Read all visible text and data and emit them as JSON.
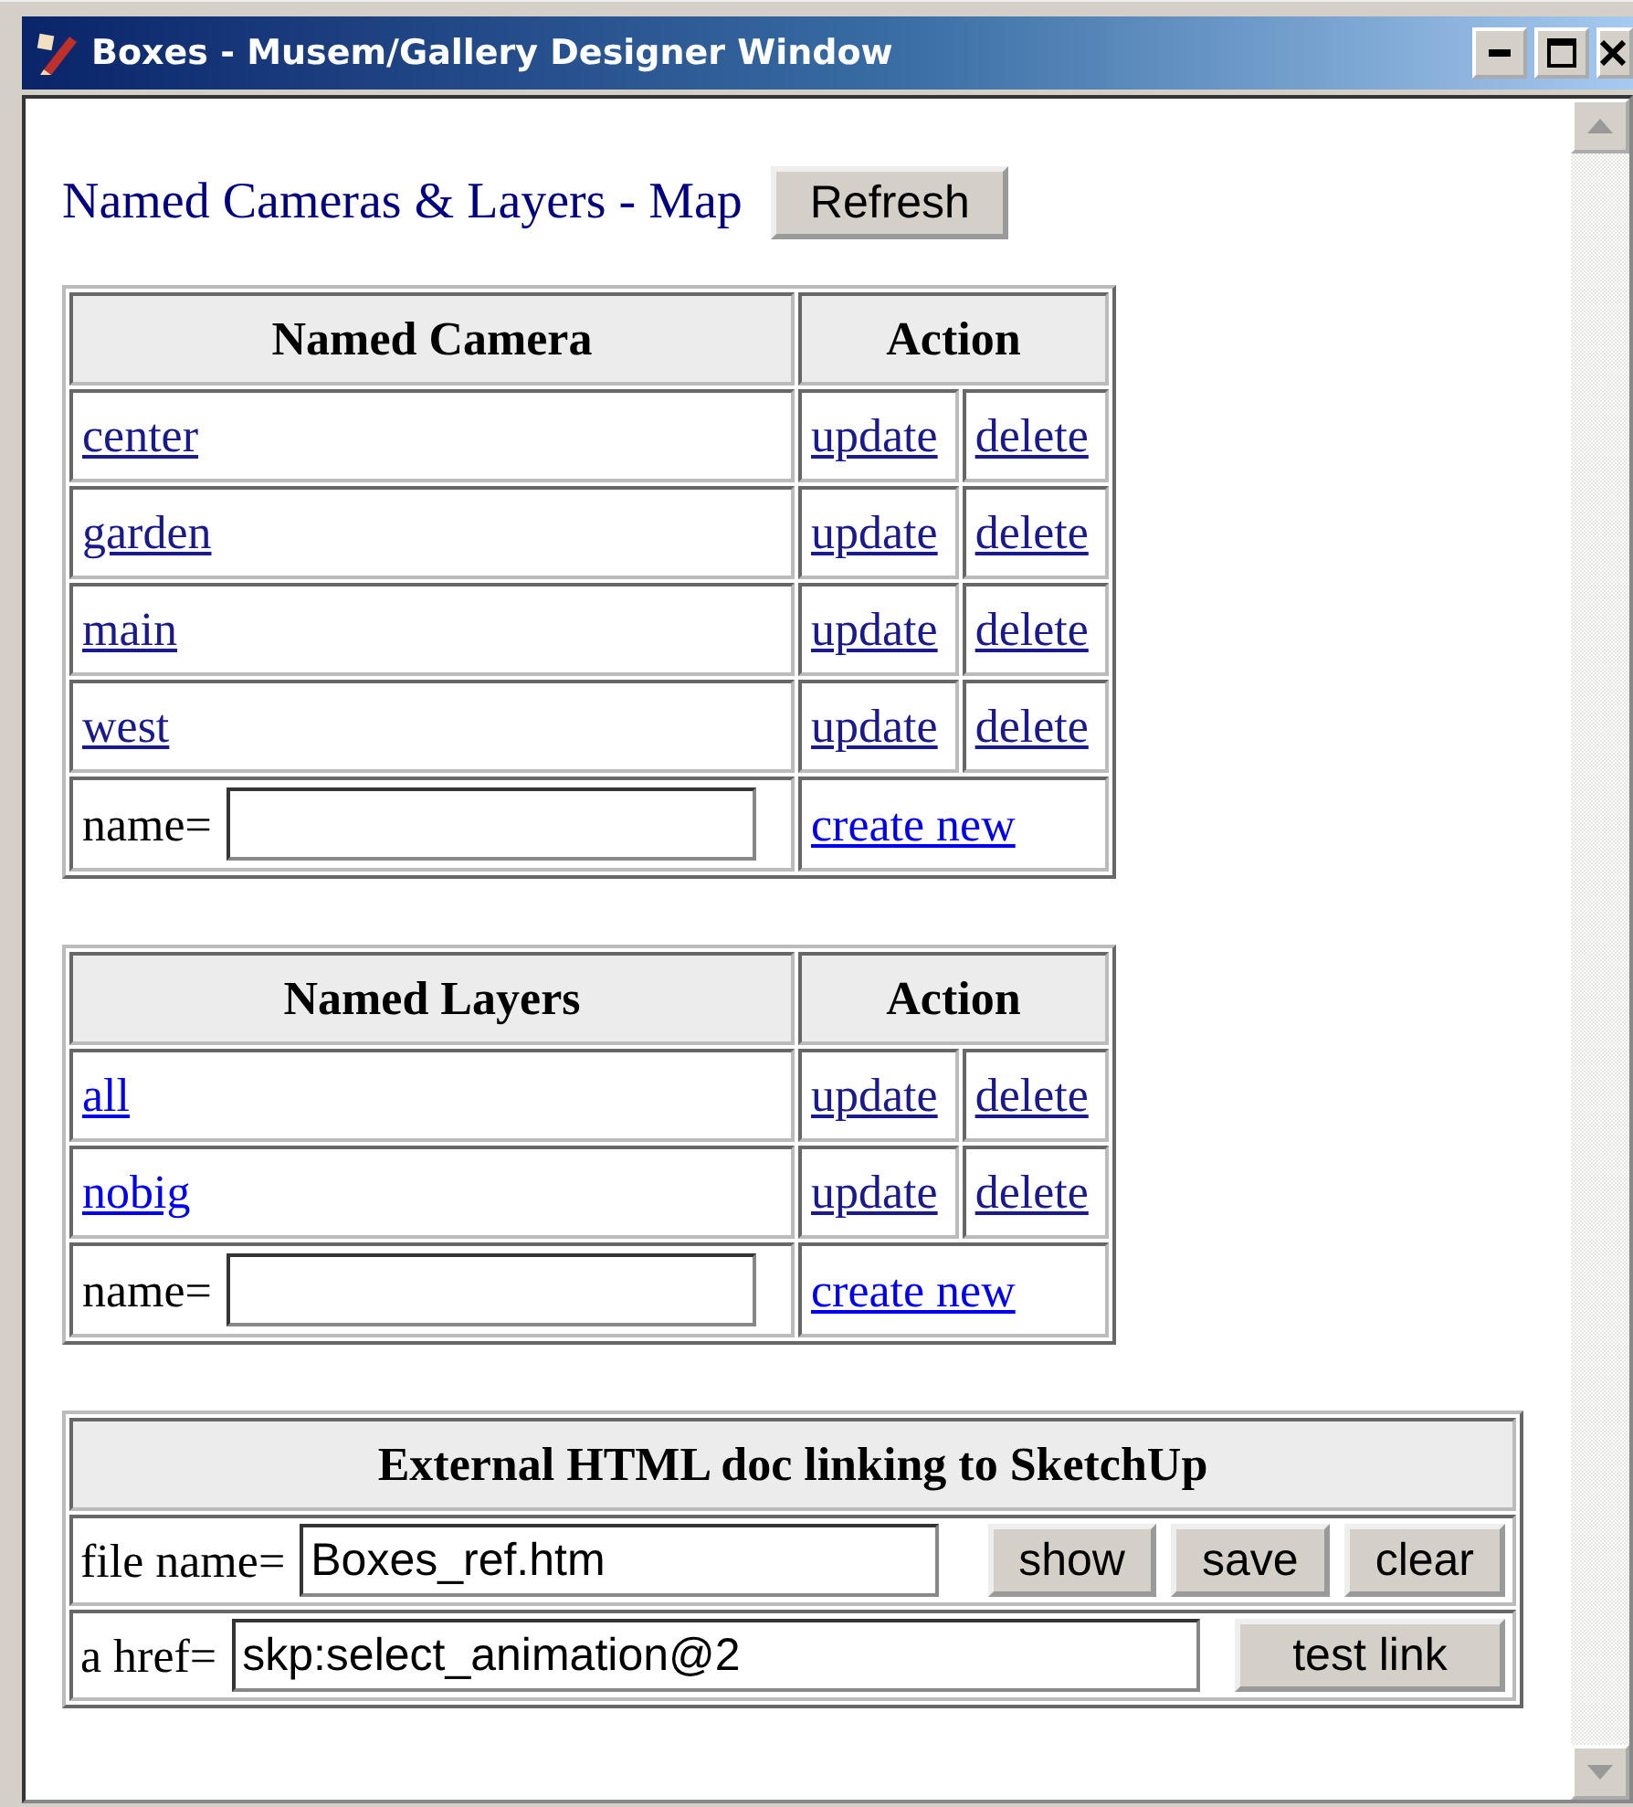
{
  "window": {
    "title": "Boxes - Musem/Gallery Designer Window"
  },
  "header": {
    "title": "Named Cameras & Layers - Map",
    "button": "Refresh"
  },
  "tables": [
    {
      "columns": [
        "Named Camera",
        "Action"
      ],
      "rows": [
        {
          "name": "center",
          "visited": true,
          "actions": [
            {
              "label": "update",
              "visited": true
            },
            {
              "label": "delete",
              "visited": true
            }
          ]
        },
        {
          "name": "garden",
          "visited": true,
          "actions": [
            {
              "label": "update",
              "visited": true
            },
            {
              "label": "delete",
              "visited": true
            }
          ]
        },
        {
          "name": "main",
          "visited": true,
          "actions": [
            {
              "label": "update",
              "visited": true
            },
            {
              "label": "delete",
              "visited": true
            }
          ]
        },
        {
          "name": "west",
          "visited": true,
          "actions": [
            {
              "label": "update",
              "visited": true
            },
            {
              "label": "delete",
              "visited": true
            }
          ]
        }
      ],
      "new_row": {
        "label": "name=",
        "link": {
          "label": "create new",
          "visited": false
        }
      }
    },
    {
      "columns": [
        "Named Layers",
        "Action"
      ],
      "rows": [
        {
          "name": "all",
          "visited": false,
          "actions": [
            {
              "label": "update",
              "visited": true
            },
            {
              "label": "delete",
              "visited": true
            }
          ]
        },
        {
          "name": "nobig",
          "visited": false,
          "actions": [
            {
              "label": "update",
              "visited": true
            },
            {
              "label": "delete",
              "visited": true
            }
          ]
        }
      ],
      "new_row": {
        "label": "name=",
        "link": {
          "label": "create new",
          "visited": false
        }
      }
    }
  ],
  "external": {
    "title": "External HTML doc linking to SketchUp",
    "rows": [
      {
        "label": "file name=",
        "value": "Boxes_ref.htm",
        "buttons": [
          "show",
          "save",
          "clear"
        ]
      },
      {
        "label": "a href=",
        "value": "skp:select_animation@2",
        "buttons": [
          "test link"
        ]
      }
    ]
  }
}
